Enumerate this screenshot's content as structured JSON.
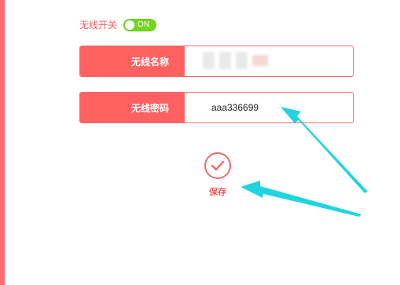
{
  "wifi_switch": {
    "label": "无线开关",
    "state_text": "ON",
    "on": true
  },
  "ssid": {
    "label": "无线名称",
    "value_obscured": true
  },
  "password": {
    "label": "无线密码",
    "value": "aaa336699"
  },
  "save": {
    "label": "保存",
    "icon": "checkmark-icon"
  },
  "annotations": {
    "arrow_color": "#22d3e0",
    "arrows": [
      "arrow-to-password",
      "arrow-to-save"
    ]
  },
  "colors": {
    "accent": "#ff6161",
    "accent_text": "#f35b5b",
    "toggle_on": "#72d51e"
  }
}
